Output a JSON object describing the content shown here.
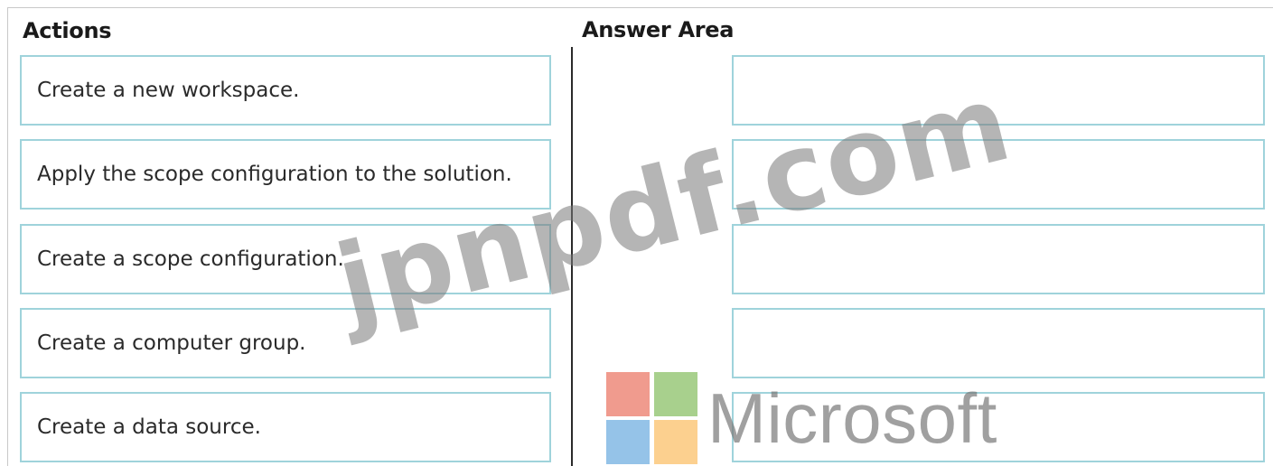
{
  "headings": {
    "actions": "Actions",
    "answer_area": "Answer Area"
  },
  "actions": [
    "Create a new workspace.",
    "Apply the scope configuration to the solution.",
    "Create a scope configuration.",
    "Create a computer group.",
    "Create a data source."
  ],
  "answer_slots": [
    "",
    "",
    "",
    "",
    ""
  ],
  "watermark": {
    "site": "jpnpdf.com",
    "logo_text": "Microsoft",
    "logo_colors": [
      "#f09b8e",
      "#a8d08d",
      "#95c3e8",
      "#fcd08f"
    ]
  },
  "colors": {
    "box_border": "#9fd3db",
    "divider": "#2b2b2b"
  }
}
